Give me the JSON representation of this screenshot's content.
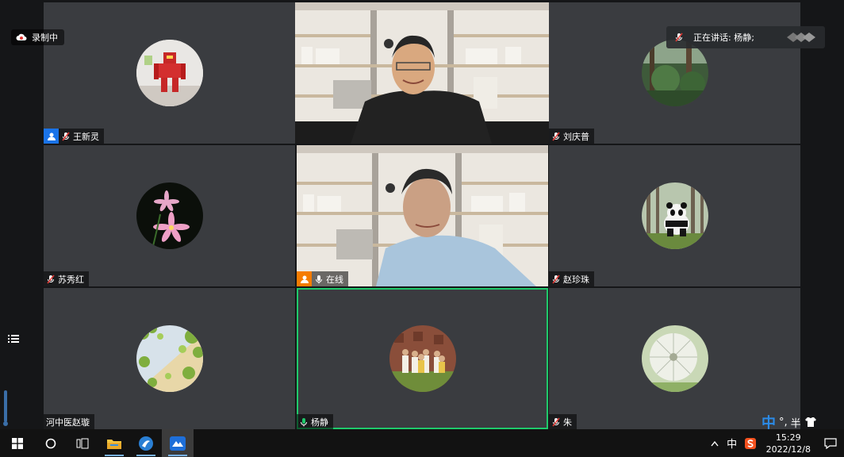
{
  "recording": {
    "label": "录制中"
  },
  "speaking": {
    "label": "正在讲话: 杨静;"
  },
  "tiles": [
    {
      "name": "王新灵",
      "kind": "avatar",
      "avatar": "robot-toy"
    },
    {
      "name": "",
      "kind": "video-top"
    },
    {
      "name": "刘庆普",
      "kind": "avatar",
      "avatar": "forest"
    },
    {
      "name": "苏秀红",
      "kind": "avatar",
      "avatar": "flowers"
    },
    {
      "name": "在线",
      "kind": "video-main"
    },
    {
      "name": "赵珍珠",
      "kind": "avatar",
      "avatar": "panda"
    },
    {
      "name": "河中医赵璇",
      "kind": "avatar",
      "avatar": "leaves"
    },
    {
      "name": "杨静",
      "kind": "avatar",
      "avatar": "group-photo"
    },
    {
      "name": "朱",
      "kind": "avatar",
      "avatar": "dandelion"
    }
  ],
  "ime": {
    "lang": "中",
    "punct": "°,",
    "width": "半"
  },
  "taskbar": {
    "time": "15:29",
    "date": "2022/12/8",
    "tray_lang": "中"
  },
  "colors": {
    "active_speaker": "#1fc96b",
    "tile_bg": "#3a3c40",
    "taskbar": "#121212"
  }
}
